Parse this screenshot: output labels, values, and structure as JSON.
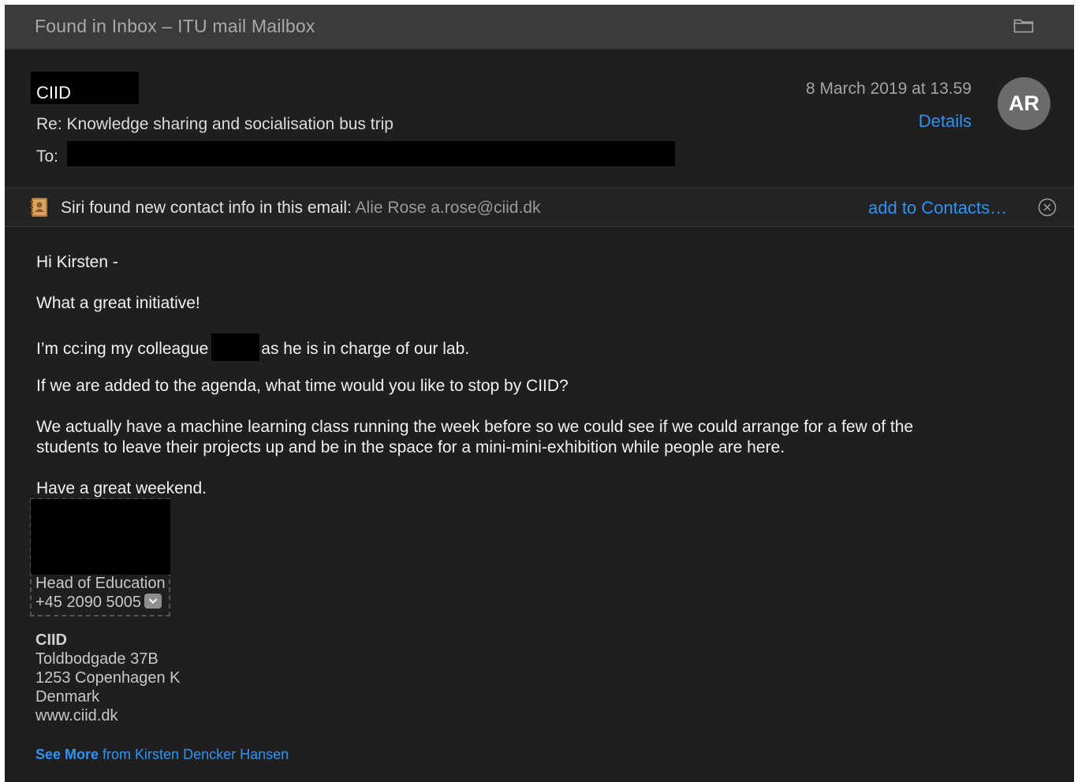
{
  "window": {
    "title": "Found in Inbox – ITU mail Mailbox"
  },
  "header": {
    "sender": "CIID",
    "subject": "Re: Knowledge sharing and socialisation bus trip",
    "to_label": "To:",
    "date": "8 March 2019 at 13.59",
    "details_label": "Details",
    "avatar_initials": "AR"
  },
  "siri_banner": {
    "prefix": "Siri found new contact info in this email:",
    "contact": "Alie Rose a.rose@ciid.dk",
    "add_label": "add to Contacts…"
  },
  "message": {
    "greeting": "Hi Kirsten -",
    "line1": "What a great initiative!",
    "line2_before": "I’m cc:ing my colleague",
    "line2_after": "as he is in charge of our lab.",
    "line3": "If we are added to the agenda, what time would you like to stop by CIID?",
    "line4a": "We actually have a machine learning class running the week before so we could see if we could arrange for a few of the",
    "line4b": "students to leave their projects up and be in the space for a mini-mini-exhibition while people are here.",
    "line5": "Have a great weekend."
  },
  "signature": {
    "role": "Head of Education",
    "phone": "+45 2090 5005",
    "org": "CIID",
    "address1": "Toldbodgade 37B",
    "address2": "1253 Copenhagen K",
    "country": "Denmark",
    "website": "www.ciid.dk"
  },
  "footer": {
    "see_more": "See More",
    "from_text": " from Kirsten Dencker Hansen"
  },
  "colors": {
    "background": "#1f1f1f",
    "titlebar": "#3b3b3b",
    "link": "#2e93f5"
  }
}
